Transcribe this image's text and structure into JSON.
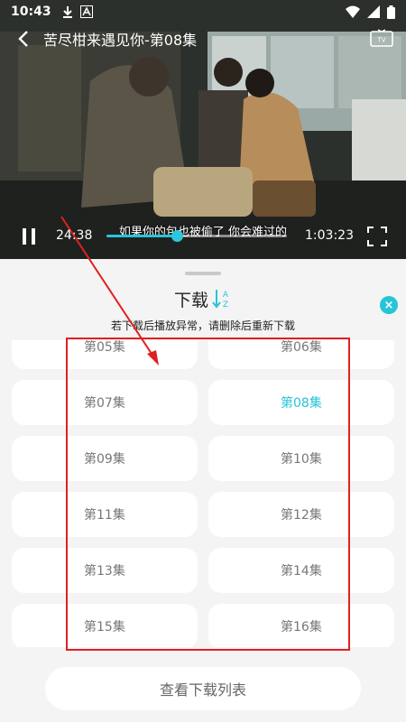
{
  "status_bar": {
    "time": "10:43"
  },
  "video": {
    "title": "苦尽柑来遇见你-第08集",
    "subtitle": "如果你的包也被偷了 你会难过的",
    "current_time": "24:38",
    "total_time": "1:03:23",
    "progress_fraction": 0.388
  },
  "panel": {
    "title": "下载",
    "notice": "若下载后播放异常，请删除后重新下载",
    "close_label": "×",
    "episodes": [
      {
        "label": "第05集",
        "active": false
      },
      {
        "label": "第06集",
        "active": false
      },
      {
        "label": "第07集",
        "active": false
      },
      {
        "label": "第08集",
        "active": true
      },
      {
        "label": "第09集",
        "active": false
      },
      {
        "label": "第10集",
        "active": false
      },
      {
        "label": "第11集",
        "active": false
      },
      {
        "label": "第12集",
        "active": false
      },
      {
        "label": "第13集",
        "active": false
      },
      {
        "label": "第14集",
        "active": false
      },
      {
        "label": "第15集",
        "active": false
      },
      {
        "label": "第16集",
        "active": false
      }
    ],
    "view_list_label": "查看下载列表"
  },
  "colors": {
    "accent": "#27c4d9",
    "annotation": "#e02020"
  },
  "icons": [
    "back-icon",
    "tv-icon",
    "pause-icon",
    "fullscreen-icon",
    "sort-icon",
    "close-icon",
    "download-icon",
    "a-icon",
    "wifi-icon",
    "signal-icon",
    "battery-icon"
  ]
}
